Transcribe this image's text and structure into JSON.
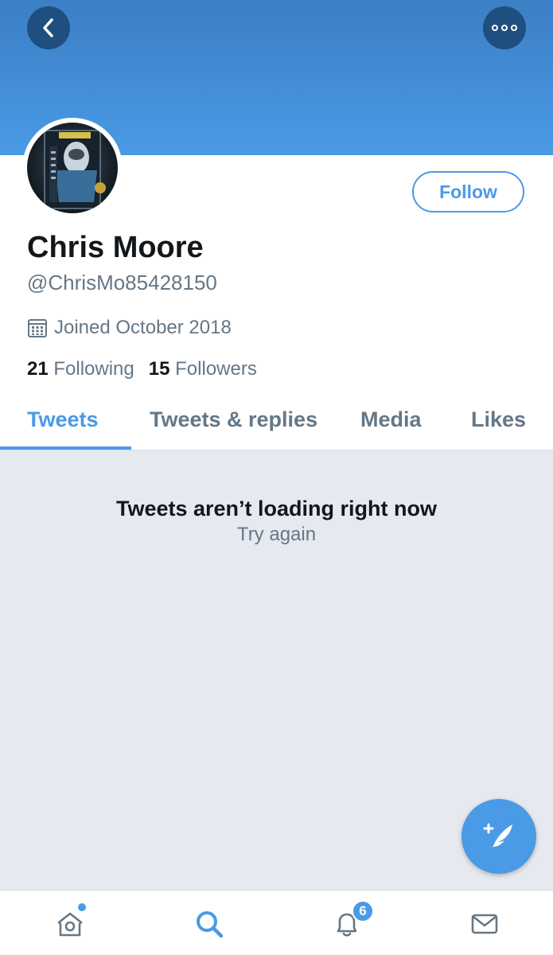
{
  "header": {
    "back_icon": "chevron-left-icon",
    "more_icon": "more-horizontal-icon"
  },
  "profile": {
    "name": "Chris Moore",
    "handle": "@ChrisMo85428150",
    "joined": "Joined October 2018",
    "following_count": "21",
    "following_label": "Following",
    "followers_count": "15",
    "followers_label": "Followers",
    "follow_label": "Follow"
  },
  "tabs": [
    {
      "label": "Tweets",
      "active": true
    },
    {
      "label": "Tweets & replies",
      "active": false
    },
    {
      "label": "Media",
      "active": false
    },
    {
      "label": "Likes",
      "active": false
    }
  ],
  "feed": {
    "error_title": "Tweets aren’t loading right now",
    "retry_label": "Try again"
  },
  "tabbar": {
    "items": [
      "home-icon",
      "search-icon",
      "notifications-icon",
      "messages-icon"
    ],
    "notification_badge": "6"
  },
  "colors": {
    "accent": "#4a9ae6",
    "banner_top": "#3b7fc4",
    "feed_background": "#e6e9ef",
    "secondary_text": "#657786"
  }
}
